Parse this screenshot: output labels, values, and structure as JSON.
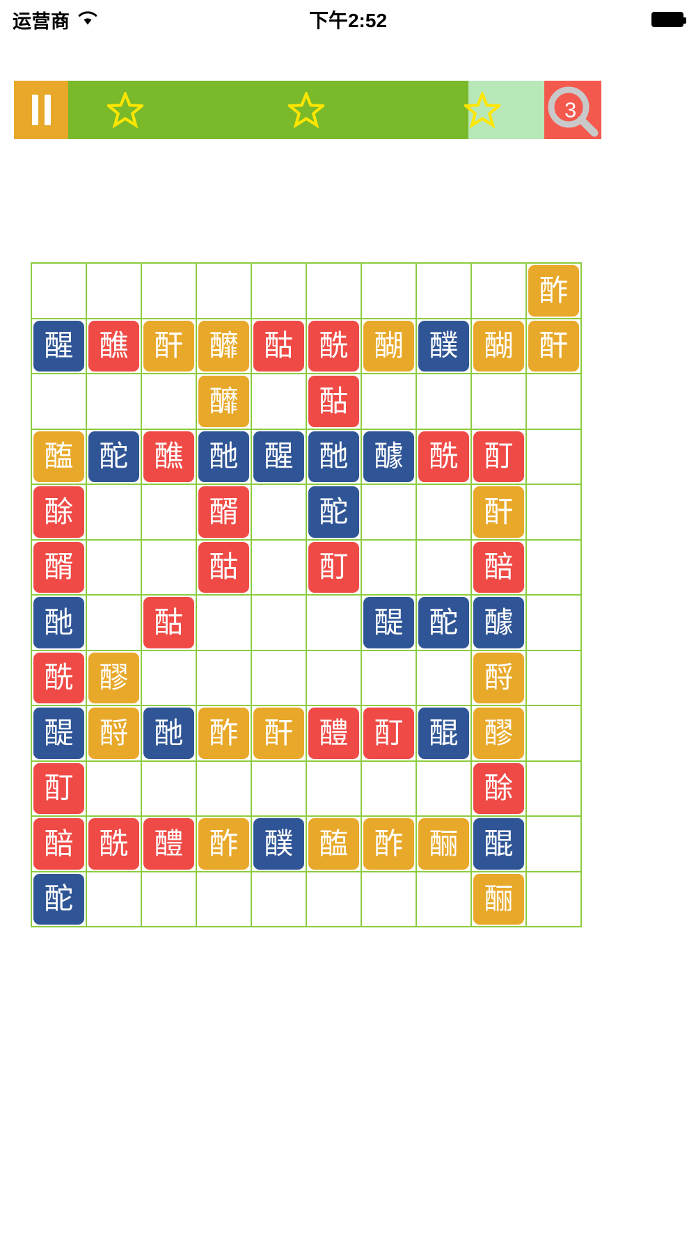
{
  "status_bar": {
    "carrier": "运营商",
    "wifi_icon": "wifi-icon",
    "time": "下午2:52",
    "battery_icon": "battery-icon"
  },
  "hud": {
    "pause_icon": "pause-icon",
    "progress_percent": 84,
    "stars": [
      {
        "name": "star-1",
        "position_percent": 12
      },
      {
        "name": "star-2",
        "position_percent": 50
      },
      {
        "name": "star-3",
        "position_percent": 87
      }
    ],
    "search_icon": "magnifier-icon",
    "search_count": "3",
    "colors": {
      "pause_bg": "#e8a829",
      "progress_fill": "#79b92a",
      "progress_track": "#b9e8b8",
      "star": "#ffe600",
      "search_bg": "#f4594e",
      "grid_line": "#8ccc3f",
      "tile_blue": "#2f5596",
      "tile_red": "#ef4a45",
      "tile_orange": "#e8a829"
    }
  },
  "board": {
    "columns": 10,
    "rows": 13,
    "grid": [
      [
        {
          "char": "",
          "color": "empty"
        },
        {
          "char": "",
          "color": "empty"
        },
        {
          "char": "",
          "color": "empty"
        },
        {
          "char": "",
          "color": "empty"
        },
        {
          "char": "",
          "color": "empty"
        },
        {
          "char": "",
          "color": "empty"
        },
        {
          "char": "",
          "color": "empty"
        },
        {
          "char": "",
          "color": "empty"
        },
        {
          "char": "",
          "color": "empty"
        },
        {
          "char": "酢",
          "color": "orange"
        }
      ],
      [
        {
          "char": "醒",
          "color": "blue"
        },
        {
          "char": "醮",
          "color": "red"
        },
        {
          "char": "酐",
          "color": "orange"
        },
        {
          "char": "釄",
          "color": "orange"
        },
        {
          "char": "酤",
          "color": "red"
        },
        {
          "char": "酰",
          "color": "red"
        },
        {
          "char": "醐",
          "color": "orange"
        },
        {
          "char": "醭",
          "color": "blue"
        },
        {
          "char": "醐",
          "color": "orange"
        },
        {
          "char": "酐",
          "color": "orange"
        }
      ],
      [
        {
          "char": "",
          "color": "empty"
        },
        {
          "char": "",
          "color": "empty"
        },
        {
          "char": "",
          "color": "empty"
        },
        {
          "char": "釄",
          "color": "orange"
        },
        {
          "char": "",
          "color": "empty"
        },
        {
          "char": "酤",
          "color": "red"
        },
        {
          "char": "",
          "color": "empty"
        },
        {
          "char": "",
          "color": "empty"
        },
        {
          "char": "",
          "color": "empty"
        },
        {
          "char": "",
          "color": "empty"
        }
      ],
      [
        {
          "char": "醢",
          "color": "orange"
        },
        {
          "char": "酡",
          "color": "blue"
        },
        {
          "char": "醮",
          "color": "red"
        },
        {
          "char": "酏",
          "color": "blue"
        },
        {
          "char": "醒",
          "color": "blue"
        },
        {
          "char": "酏",
          "color": "blue"
        },
        {
          "char": "醵",
          "color": "blue"
        },
        {
          "char": "酰",
          "color": "red"
        },
        {
          "char": "酊",
          "color": "red"
        },
        {
          "char": "",
          "color": "empty"
        }
      ],
      [
        {
          "char": "酴",
          "color": "red"
        },
        {
          "char": "",
          "color": "empty"
        },
        {
          "char": "",
          "color": "empty"
        },
        {
          "char": "醑",
          "color": "red"
        },
        {
          "char": "",
          "color": "empty"
        },
        {
          "char": "酡",
          "color": "blue"
        },
        {
          "char": "",
          "color": "empty"
        },
        {
          "char": "",
          "color": "empty"
        },
        {
          "char": "酐",
          "color": "orange"
        },
        {
          "char": "",
          "color": "empty"
        }
      ],
      [
        {
          "char": "醑",
          "color": "red"
        },
        {
          "char": "",
          "color": "empty"
        },
        {
          "char": "",
          "color": "empty"
        },
        {
          "char": "酤",
          "color": "red"
        },
        {
          "char": "",
          "color": "empty"
        },
        {
          "char": "酊",
          "color": "red"
        },
        {
          "char": "",
          "color": "empty"
        },
        {
          "char": "",
          "color": "empty"
        },
        {
          "char": "醅",
          "color": "red"
        },
        {
          "char": "",
          "color": "empty"
        }
      ],
      [
        {
          "char": "酏",
          "color": "blue"
        },
        {
          "char": "",
          "color": "empty"
        },
        {
          "char": "酤",
          "color": "red"
        },
        {
          "char": "",
          "color": "empty"
        },
        {
          "char": "",
          "color": "empty"
        },
        {
          "char": "",
          "color": "empty"
        },
        {
          "char": "醍",
          "color": "blue"
        },
        {
          "char": "酡",
          "color": "blue"
        },
        {
          "char": "醵",
          "color": "blue"
        },
        {
          "char": "",
          "color": "empty"
        }
      ],
      [
        {
          "char": "酰",
          "color": "red"
        },
        {
          "char": "醪",
          "color": "orange"
        },
        {
          "char": "",
          "color": "empty"
        },
        {
          "char": "",
          "color": "empty"
        },
        {
          "char": "",
          "color": "empty"
        },
        {
          "char": "",
          "color": "empty"
        },
        {
          "char": "",
          "color": "empty"
        },
        {
          "char": "",
          "color": "empty"
        },
        {
          "char": "酹",
          "color": "orange"
        },
        {
          "char": "",
          "color": "empty"
        }
      ],
      [
        {
          "char": "醍",
          "color": "blue"
        },
        {
          "char": "酹",
          "color": "orange"
        },
        {
          "char": "酏",
          "color": "blue"
        },
        {
          "char": "酢",
          "color": "orange"
        },
        {
          "char": "酐",
          "color": "orange"
        },
        {
          "char": "醴",
          "color": "red"
        },
        {
          "char": "酊",
          "color": "red"
        },
        {
          "char": "醌",
          "color": "blue"
        },
        {
          "char": "醪",
          "color": "orange"
        },
        {
          "char": "",
          "color": "empty"
        }
      ],
      [
        {
          "char": "酊",
          "color": "red"
        },
        {
          "char": "",
          "color": "empty"
        },
        {
          "char": "",
          "color": "empty"
        },
        {
          "char": "",
          "color": "empty"
        },
        {
          "char": "",
          "color": "empty"
        },
        {
          "char": "",
          "color": "empty"
        },
        {
          "char": "",
          "color": "empty"
        },
        {
          "char": "",
          "color": "empty"
        },
        {
          "char": "酴",
          "color": "red"
        },
        {
          "char": "",
          "color": "empty"
        }
      ],
      [
        {
          "char": "醅",
          "color": "red"
        },
        {
          "char": "酰",
          "color": "red"
        },
        {
          "char": "醴",
          "color": "red"
        },
        {
          "char": "酢",
          "color": "orange"
        },
        {
          "char": "醭",
          "color": "blue"
        },
        {
          "char": "醢",
          "color": "orange"
        },
        {
          "char": "酢",
          "color": "orange"
        },
        {
          "char": "酾",
          "color": "orange"
        },
        {
          "char": "醌",
          "color": "blue"
        },
        {
          "char": "",
          "color": "empty"
        }
      ],
      [
        {
          "char": "酡",
          "color": "blue"
        },
        {
          "char": "",
          "color": "empty"
        },
        {
          "char": "",
          "color": "empty"
        },
        {
          "char": "",
          "color": "empty"
        },
        {
          "char": "",
          "color": "empty"
        },
        {
          "char": "",
          "color": "empty"
        },
        {
          "char": "",
          "color": "empty"
        },
        {
          "char": "",
          "color": "empty"
        },
        {
          "char": "酾",
          "color": "orange"
        },
        {
          "char": "",
          "color": "empty"
        }
      ]
    ]
  }
}
